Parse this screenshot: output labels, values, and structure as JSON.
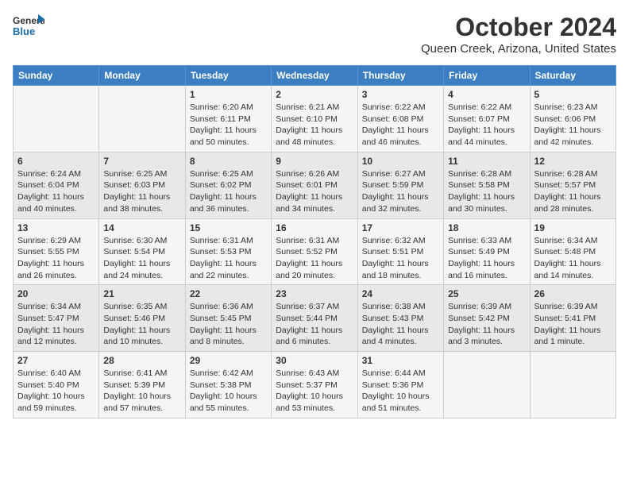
{
  "logo": {
    "line1": "General",
    "line2": "Blue"
  },
  "title": "October 2024",
  "subtitle": "Queen Creek, Arizona, United States",
  "days_of_week": [
    "Sunday",
    "Monday",
    "Tuesday",
    "Wednesday",
    "Thursday",
    "Friday",
    "Saturday"
  ],
  "weeks": [
    [
      {
        "day": "",
        "content": ""
      },
      {
        "day": "",
        "content": ""
      },
      {
        "day": "1",
        "content": "Sunrise: 6:20 AM\nSunset: 6:11 PM\nDaylight: 11 hours and 50 minutes."
      },
      {
        "day": "2",
        "content": "Sunrise: 6:21 AM\nSunset: 6:10 PM\nDaylight: 11 hours and 48 minutes."
      },
      {
        "day": "3",
        "content": "Sunrise: 6:22 AM\nSunset: 6:08 PM\nDaylight: 11 hours and 46 minutes."
      },
      {
        "day": "4",
        "content": "Sunrise: 6:22 AM\nSunset: 6:07 PM\nDaylight: 11 hours and 44 minutes."
      },
      {
        "day": "5",
        "content": "Sunrise: 6:23 AM\nSunset: 6:06 PM\nDaylight: 11 hours and 42 minutes."
      }
    ],
    [
      {
        "day": "6",
        "content": "Sunrise: 6:24 AM\nSunset: 6:04 PM\nDaylight: 11 hours and 40 minutes."
      },
      {
        "day": "7",
        "content": "Sunrise: 6:25 AM\nSunset: 6:03 PM\nDaylight: 11 hours and 38 minutes."
      },
      {
        "day": "8",
        "content": "Sunrise: 6:25 AM\nSunset: 6:02 PM\nDaylight: 11 hours and 36 minutes."
      },
      {
        "day": "9",
        "content": "Sunrise: 6:26 AM\nSunset: 6:01 PM\nDaylight: 11 hours and 34 minutes."
      },
      {
        "day": "10",
        "content": "Sunrise: 6:27 AM\nSunset: 5:59 PM\nDaylight: 11 hours and 32 minutes."
      },
      {
        "day": "11",
        "content": "Sunrise: 6:28 AM\nSunset: 5:58 PM\nDaylight: 11 hours and 30 minutes."
      },
      {
        "day": "12",
        "content": "Sunrise: 6:28 AM\nSunset: 5:57 PM\nDaylight: 11 hours and 28 minutes."
      }
    ],
    [
      {
        "day": "13",
        "content": "Sunrise: 6:29 AM\nSunset: 5:55 PM\nDaylight: 11 hours and 26 minutes."
      },
      {
        "day": "14",
        "content": "Sunrise: 6:30 AM\nSunset: 5:54 PM\nDaylight: 11 hours and 24 minutes."
      },
      {
        "day": "15",
        "content": "Sunrise: 6:31 AM\nSunset: 5:53 PM\nDaylight: 11 hours and 22 minutes."
      },
      {
        "day": "16",
        "content": "Sunrise: 6:31 AM\nSunset: 5:52 PM\nDaylight: 11 hours and 20 minutes."
      },
      {
        "day": "17",
        "content": "Sunrise: 6:32 AM\nSunset: 5:51 PM\nDaylight: 11 hours and 18 minutes."
      },
      {
        "day": "18",
        "content": "Sunrise: 6:33 AM\nSunset: 5:49 PM\nDaylight: 11 hours and 16 minutes."
      },
      {
        "day": "19",
        "content": "Sunrise: 6:34 AM\nSunset: 5:48 PM\nDaylight: 11 hours and 14 minutes."
      }
    ],
    [
      {
        "day": "20",
        "content": "Sunrise: 6:34 AM\nSunset: 5:47 PM\nDaylight: 11 hours and 12 minutes."
      },
      {
        "day": "21",
        "content": "Sunrise: 6:35 AM\nSunset: 5:46 PM\nDaylight: 11 hours and 10 minutes."
      },
      {
        "day": "22",
        "content": "Sunrise: 6:36 AM\nSunset: 5:45 PM\nDaylight: 11 hours and 8 minutes."
      },
      {
        "day": "23",
        "content": "Sunrise: 6:37 AM\nSunset: 5:44 PM\nDaylight: 11 hours and 6 minutes."
      },
      {
        "day": "24",
        "content": "Sunrise: 6:38 AM\nSunset: 5:43 PM\nDaylight: 11 hours and 4 minutes."
      },
      {
        "day": "25",
        "content": "Sunrise: 6:39 AM\nSunset: 5:42 PM\nDaylight: 11 hours and 3 minutes."
      },
      {
        "day": "26",
        "content": "Sunrise: 6:39 AM\nSunset: 5:41 PM\nDaylight: 11 hours and 1 minute."
      }
    ],
    [
      {
        "day": "27",
        "content": "Sunrise: 6:40 AM\nSunset: 5:40 PM\nDaylight: 10 hours and 59 minutes."
      },
      {
        "day": "28",
        "content": "Sunrise: 6:41 AM\nSunset: 5:39 PM\nDaylight: 10 hours and 57 minutes."
      },
      {
        "day": "29",
        "content": "Sunrise: 6:42 AM\nSunset: 5:38 PM\nDaylight: 10 hours and 55 minutes."
      },
      {
        "day": "30",
        "content": "Sunrise: 6:43 AM\nSunset: 5:37 PM\nDaylight: 10 hours and 53 minutes."
      },
      {
        "day": "31",
        "content": "Sunrise: 6:44 AM\nSunset: 5:36 PM\nDaylight: 10 hours and 51 minutes."
      },
      {
        "day": "",
        "content": ""
      },
      {
        "day": "",
        "content": ""
      }
    ]
  ]
}
